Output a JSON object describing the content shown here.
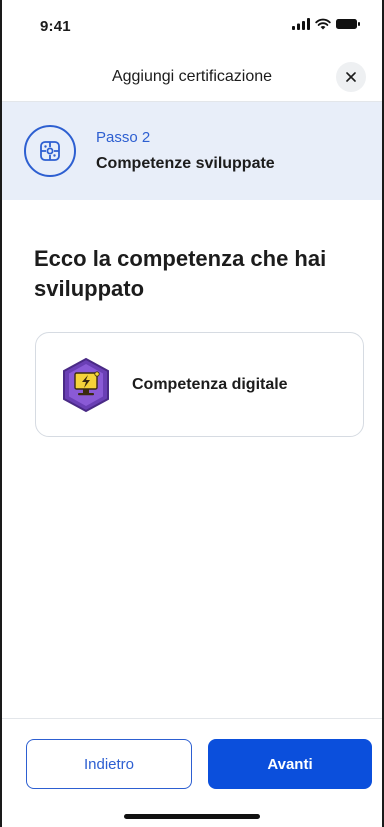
{
  "status_bar": {
    "time": "9:41",
    "icons": [
      "signal-icon",
      "wifi-icon",
      "battery-icon"
    ]
  },
  "header": {
    "title": "Aggiungi certificazione",
    "close_icon": "close-icon"
  },
  "step": {
    "number_label": "Passo 2",
    "name": "Competenze sviluppate",
    "icon": "puzzle-icon"
  },
  "main": {
    "heading": "Ecco la competenza che hai sviluppato",
    "competences": [
      {
        "label": "Competenza digitale",
        "icon": "digital-competence-badge-icon"
      }
    ]
  },
  "footer": {
    "back_label": "Indietro",
    "next_label": "Avanti"
  },
  "colors": {
    "accent": "#2d5fd1",
    "primary_button": "#0b4fdc",
    "banner_background": "#e8eef9",
    "badge_purple": "#6a3fb5",
    "badge_yellow": "#f5d33a"
  }
}
